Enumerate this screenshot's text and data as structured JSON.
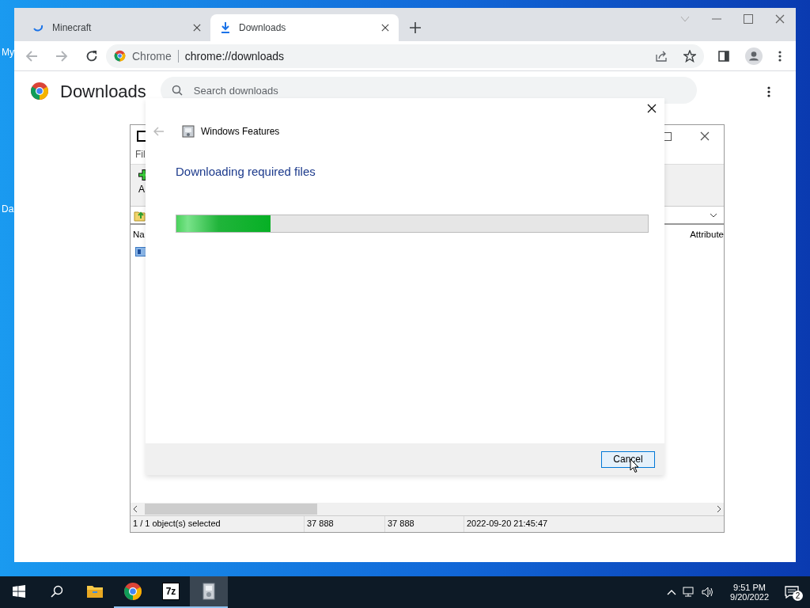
{
  "desktop": {
    "icon_labels": [
      "My",
      "Da"
    ]
  },
  "browser": {
    "tabs": [
      {
        "title": "Minecraft",
        "kind": "loading",
        "selected": false
      },
      {
        "title": "Downloads",
        "kind": "download",
        "selected": true
      }
    ],
    "address": {
      "origin": "Chrome",
      "url": "chrome://downloads"
    },
    "page": {
      "title": "Downloads",
      "search": {
        "placeholder": "Search downloads"
      }
    }
  },
  "archive_window": {
    "menu": [
      "Fil"
    ],
    "toolbar_label": "A",
    "columns": [
      "Na",
      "Attribute"
    ],
    "status_bar": [
      "1 / 1 object(s) selected",
      "37 888",
      "37 888",
      "2022-09-20 21:45:47"
    ]
  },
  "dialog": {
    "title": "Windows Features",
    "heading": "Downloading required files",
    "progress": {
      "level": 0.2
    },
    "buttons": [
      {
        "label": "Cancel",
        "focused": true
      }
    ]
  },
  "taskbar": {
    "apps": [
      {
        "kind": "explorer",
        "running": false,
        "selected": false
      },
      {
        "kind": "chrome",
        "running": true,
        "selected": false
      },
      {
        "kind": "archiver",
        "label": "7z",
        "running": true,
        "selected": false
      },
      {
        "kind": "features",
        "running": true,
        "selected": true
      }
    ],
    "clock": {
      "time": "9:51 PM",
      "date": "9/20/2022"
    },
    "notifications": "2"
  }
}
